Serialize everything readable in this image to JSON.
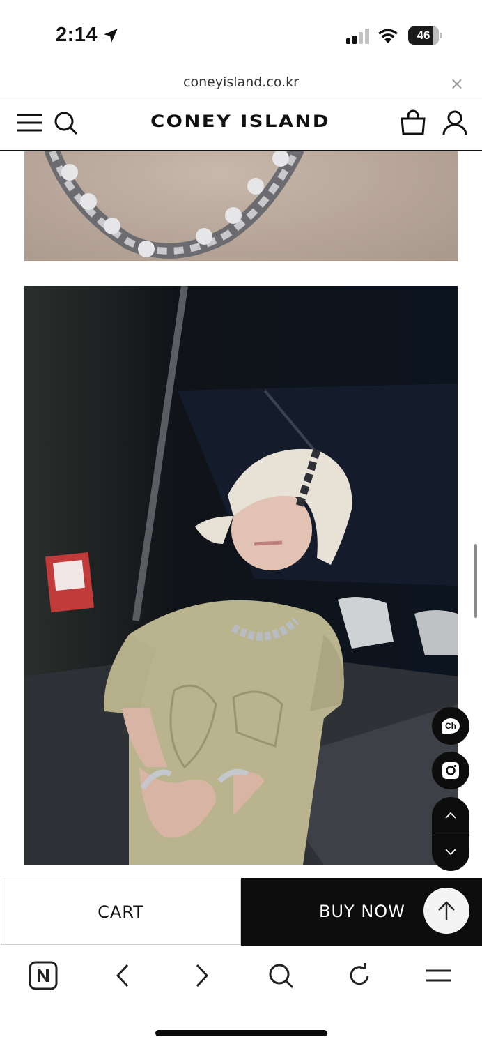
{
  "status_bar": {
    "time": "2:14",
    "battery": "46"
  },
  "browser": {
    "url": "coneyisland.co.kr",
    "close_glyph": "×"
  },
  "header": {
    "brand": "CONEY ISLAND",
    "icons": [
      "menu-icon",
      "search-icon",
      "shopping-bag-icon",
      "user-icon"
    ]
  },
  "product_images": [
    {
      "name": "photo-necklace-closeup"
    },
    {
      "name": "photo-model-bandana"
    }
  ],
  "floating": {
    "channel_label": "Ch",
    "icons": [
      "channel-talk-icon",
      "instagram-icon",
      "chevron-up-icon",
      "chevron-down-icon"
    ]
  },
  "purchase_bar": {
    "cart_label": "CART",
    "buy_label": "BUY NOW"
  },
  "toolbar": {
    "icons": [
      "naver-home-icon",
      "back-icon",
      "forward-icon",
      "search-icon",
      "refresh-icon",
      "menu-icon"
    ]
  },
  "colors": {
    "black": "#0d0d0d",
    "white": "#ffffff",
    "divider": "#d9d9d9"
  }
}
